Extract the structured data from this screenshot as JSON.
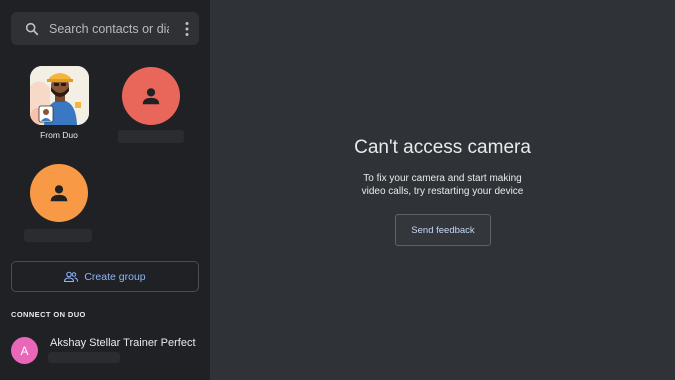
{
  "search": {
    "placeholder": "Search contacts or dial",
    "icon": "search-icon",
    "menu_icon": "more-vert-icon"
  },
  "contacts": {
    "tiles": [
      {
        "label": "From Duo",
        "kind": "photo"
      },
      {
        "label": "",
        "kind": "person-icon",
        "color": "#e9665b"
      },
      {
        "label": "",
        "kind": "person-icon",
        "color": "#f89a45"
      }
    ]
  },
  "create_group": {
    "label": "Create group",
    "icon": "group-add-icon",
    "color": "#8ab4f8"
  },
  "connect_section": {
    "heading": "CONNECT ON DUO",
    "contact": {
      "initial": "A",
      "name": "Akshay Stellar Trainer Perfect",
      "avatar_color": "#e967b8"
    }
  },
  "camera_panel": {
    "title": "Can't access camera",
    "message_line1": "To fix your camera and start making",
    "message_line2": "video calls, try restarting your device",
    "feedback_button": "Send feedback"
  }
}
